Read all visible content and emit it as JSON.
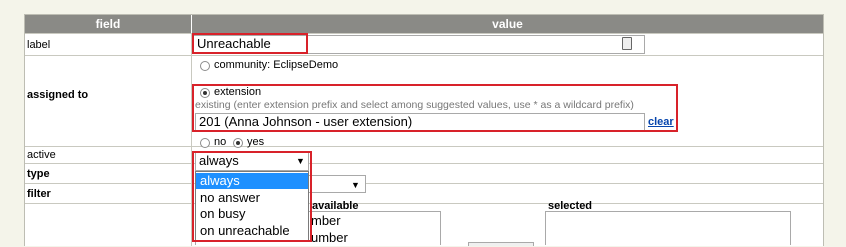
{
  "columns": {
    "field": "field",
    "value": "value"
  },
  "label_row": {
    "label": "label",
    "value": "Unreachable"
  },
  "assigned_row": {
    "label": "assigned to",
    "option_community": "community: EclipseDemo",
    "option_extension": "extension",
    "hint": "existing (enter extension prefix and select among suggested values, use * as a wildcard prefix)",
    "extension_value": "201  (Anna Johnson - user extension)",
    "clear_label": "clear"
  },
  "active_row": {
    "label": "active",
    "no": "no",
    "yes": "yes",
    "selected": "yes"
  },
  "type_row": {
    "label": "type",
    "selected": "always",
    "options": [
      "always",
      "no answer",
      "on busy",
      "on unreachable"
    ]
  },
  "filter_row": {
    "label": "filter"
  },
  "bottom": {
    "available_label": "available",
    "selected_label": "selected",
    "visible_items": [
      "mber",
      "umber"
    ]
  }
}
